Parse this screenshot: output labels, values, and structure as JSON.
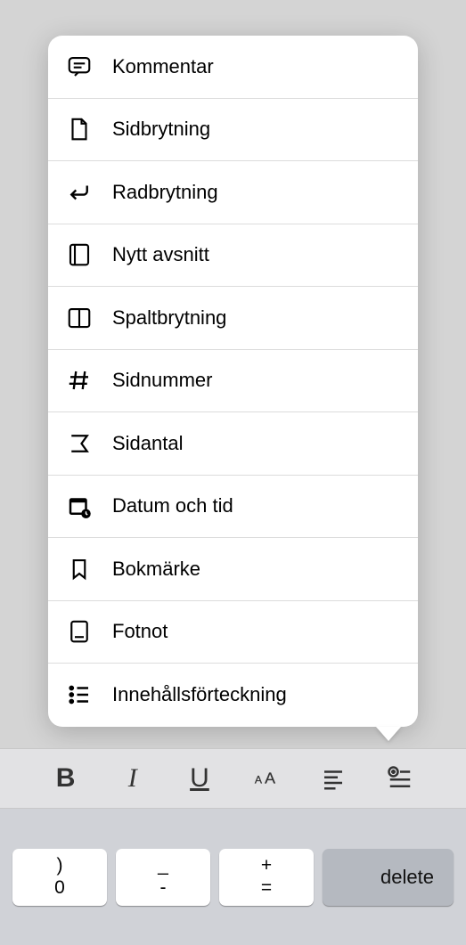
{
  "menu": {
    "items": [
      {
        "icon": "comment-icon",
        "label": "Kommentar"
      },
      {
        "icon": "page-break-icon",
        "label": "Sidbrytning"
      },
      {
        "icon": "line-break-icon",
        "label": "Radbrytning"
      },
      {
        "icon": "section-break-icon",
        "label": "Nytt avsnitt"
      },
      {
        "icon": "column-break-icon",
        "label": "Spaltbrytning"
      },
      {
        "icon": "page-number-icon",
        "label": "Sidnummer"
      },
      {
        "icon": "page-count-icon",
        "label": "Sidantal"
      },
      {
        "icon": "date-time-icon",
        "label": "Datum och tid"
      },
      {
        "icon": "bookmark-icon",
        "label": "Bokmärke"
      },
      {
        "icon": "footnote-icon",
        "label": "Fotnot"
      },
      {
        "icon": "toc-icon",
        "label": "Innehållsförteckning"
      }
    ]
  },
  "toolbar": {
    "bold": "B",
    "italic": "I",
    "underline": "U"
  },
  "keyboard": {
    "key0_top": ")",
    "key0_bottom": "0",
    "key1_top": "_",
    "key1_bottom": "-",
    "key2_top": "+",
    "key2_bottom": "=",
    "delete": "delete"
  }
}
